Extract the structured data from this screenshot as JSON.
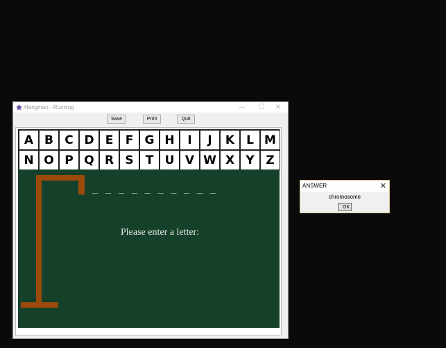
{
  "window": {
    "title": "Hangman - Running",
    "controls": {
      "minimize": "—",
      "maximize": "☐",
      "close": "✕"
    }
  },
  "toolbar": {
    "save_label": "Save",
    "print_label": "Print",
    "quit_label": "Quit"
  },
  "letters": {
    "row1": [
      "A",
      "B",
      "C",
      "D",
      "E",
      "F",
      "G",
      "H",
      "I",
      "J",
      "K",
      "L",
      "M"
    ],
    "row2": [
      "N",
      "O",
      "P",
      "Q",
      "R",
      "S",
      "T",
      "U",
      "V",
      "W",
      "X",
      "Y",
      "Z"
    ]
  },
  "game": {
    "word_blanks": "_ _ _ _ _ _ _ _ _ _",
    "prompt": "Please enter a letter:"
  },
  "dialog": {
    "title": "ANSWER",
    "message": "chromosome",
    "ok_label": "OK",
    "close_glyph": "✕"
  },
  "colors": {
    "board": "#15402a",
    "gallows": "#9a4a0a",
    "desktop": "#0a0a0a"
  }
}
